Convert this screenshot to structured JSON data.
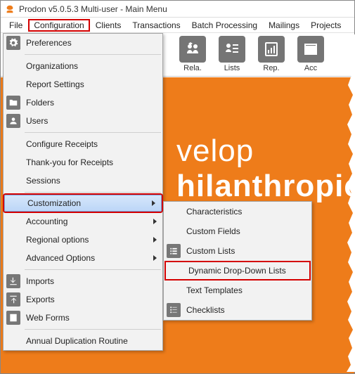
{
  "window": {
    "title": "Prodon v5.0.5.3 Multi-user - Main Menu"
  },
  "menubar": {
    "file": "File",
    "configuration": "Configuration",
    "clients": "Clients",
    "transactions": "Transactions",
    "batch": "Batch Processing",
    "mailings": "Mailings",
    "projects": "Projects"
  },
  "toolbar": {
    "rela": "Rela.",
    "lists": "Lists",
    "rep": "Rep.",
    "acc": "Acc"
  },
  "bg": {
    "w1": "velop",
    "w2": "hilanthropic"
  },
  "config_menu": {
    "preferences": "Preferences",
    "organizations": "Organizations",
    "report_settings": "Report Settings",
    "folders": "Folders",
    "users": "Users",
    "configure_receipts": "Configure Receipts",
    "thank_you": "Thank-you for Receipts",
    "sessions": "Sessions",
    "customization": "Customization",
    "accounting": "Accounting",
    "regional": "Regional options",
    "advanced": "Advanced Options",
    "imports": "Imports",
    "exports": "Exports",
    "web_forms": "Web Forms",
    "annual_dup": "Annual Duplication Routine"
  },
  "customization_menu": {
    "characteristics": "Characteristics",
    "custom_fields": "Custom Fields",
    "custom_lists": "Custom Lists",
    "dyn_dd": "Dynamic Drop-Down Lists",
    "text_templates": "Text Templates",
    "checklists": "Checklists"
  }
}
